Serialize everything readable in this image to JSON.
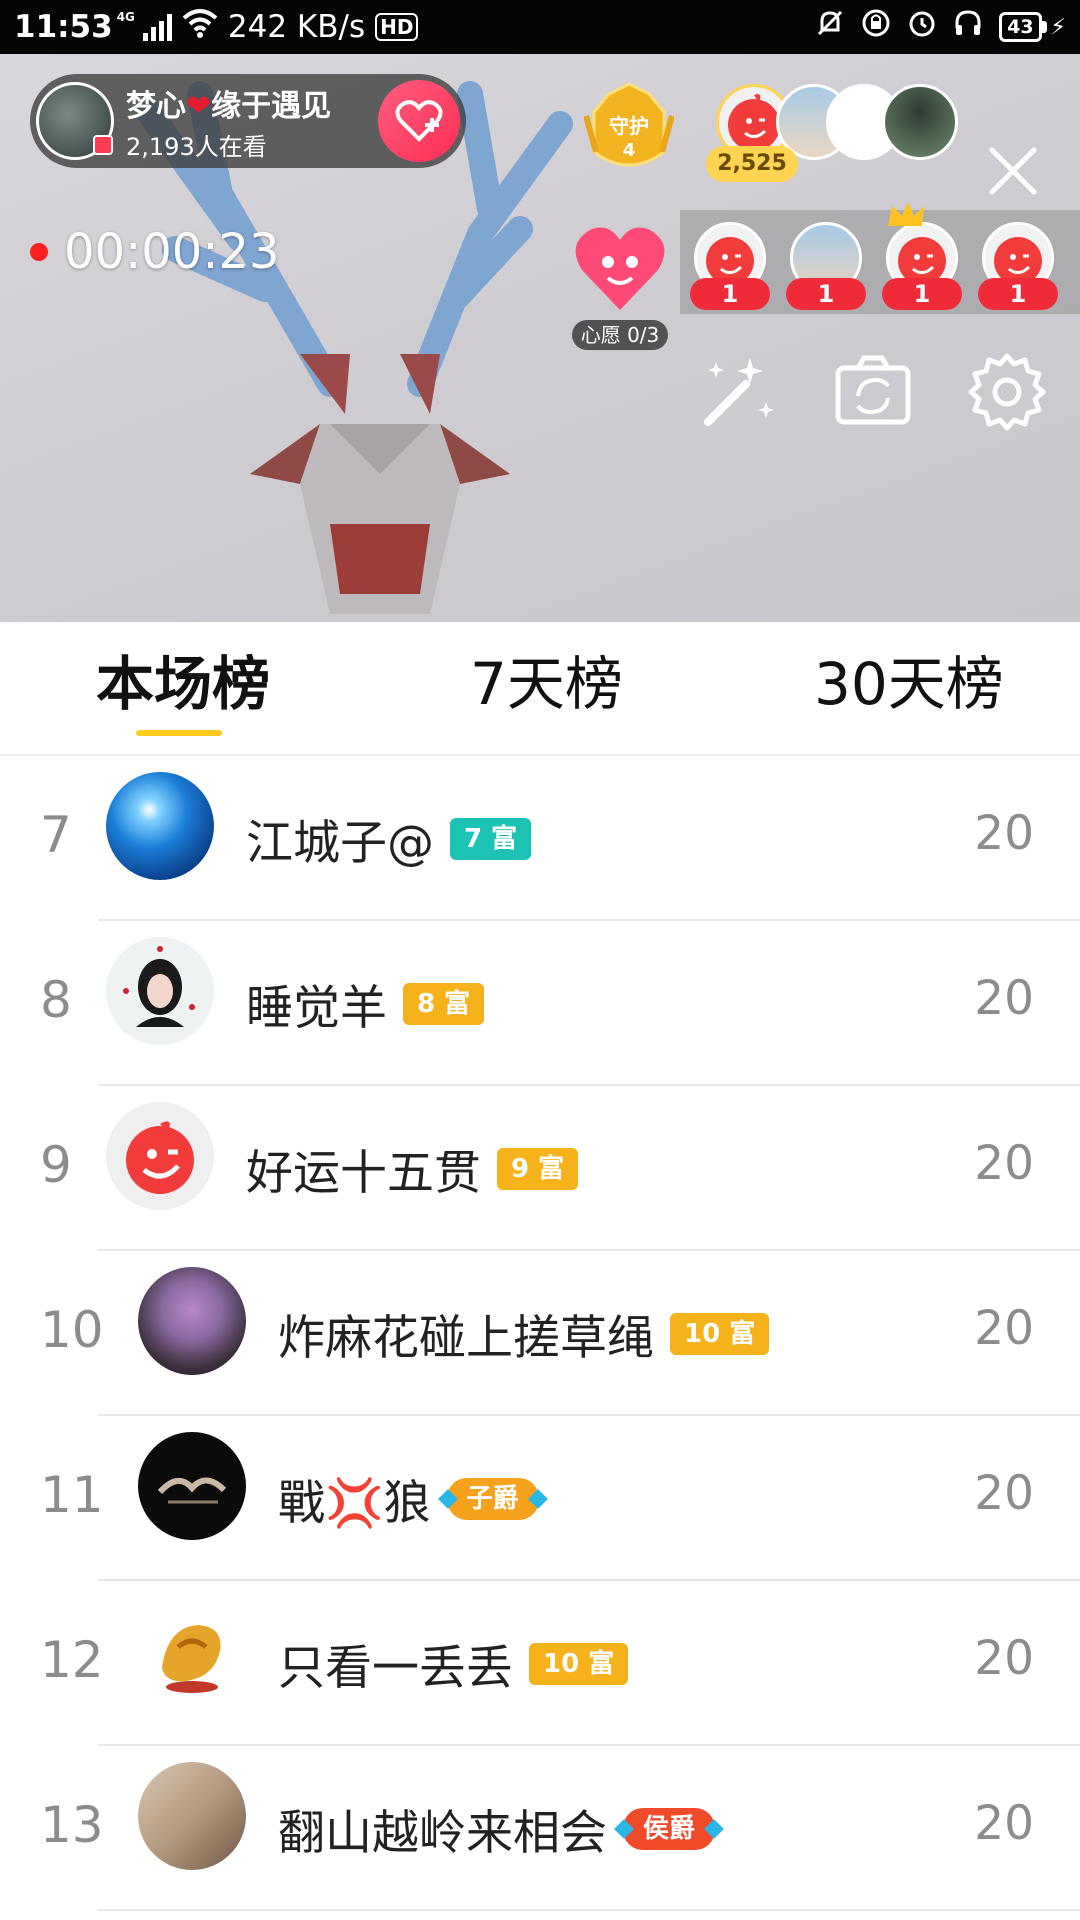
{
  "status_bar": {
    "time": "11:53",
    "network": "4G",
    "speed": "242 KB/s",
    "hd": "HD",
    "battery": "43"
  },
  "live": {
    "anchor_name": "梦心",
    "anchor_name_suffix": "缘于遇见",
    "viewers": "2,193人在看",
    "guard_label": "守护",
    "guard_count": "4",
    "score": "2,525",
    "timer": "00:00:23",
    "wish_label": "心愿 0/3",
    "fans": [
      {
        "count": "1",
        "style": "mascot"
      },
      {
        "count": "1",
        "style": "photo"
      },
      {
        "count": "1",
        "style": "crown"
      },
      {
        "count": "1",
        "style": "mascot"
      }
    ]
  },
  "tabs": [
    {
      "label": "本场榜",
      "active": true
    },
    {
      "label": "7天榜",
      "active": false
    },
    {
      "label": "30天榜",
      "active": false
    }
  ],
  "leaderboard": [
    {
      "rank": "7",
      "name": "江城子@",
      "badge": "7 富",
      "badge_color": "#1cc3b5",
      "badge_kind": "wealth",
      "score": "20",
      "avatar": "blue-light"
    },
    {
      "rank": "8",
      "name": "睡觉羊",
      "badge": "8 富",
      "badge_color": "#f5b21b",
      "badge_kind": "wealth",
      "score": "20",
      "avatar": "girl-portrait"
    },
    {
      "rank": "9",
      "name": "好运十五贯",
      "badge": "9 富",
      "badge_color": "#f5b21b",
      "badge_kind": "wealth",
      "score": "20",
      "avatar": "mascot"
    },
    {
      "rank": "10",
      "name": "炸麻花碰上搓草绳",
      "badge": "10 富",
      "badge_color": "#f5b21b",
      "badge_kind": "wealth",
      "score": "20",
      "avatar": "flowers"
    },
    {
      "rank": "11",
      "name": "戰💢狼",
      "badge": "子爵",
      "badge_color": "#f7a21c",
      "badge_kind": "noble",
      "score": "20",
      "avatar": "black-logo"
    },
    {
      "rank": "12",
      "name": "只看一丢丢",
      "badge": "10 富",
      "badge_color": "#f5b21b",
      "badge_kind": "wealth",
      "score": "20",
      "avatar": "gold-dragon"
    },
    {
      "rank": "13",
      "name": "翻山越岭来相会",
      "badge": "侯爵",
      "badge_color": "#ef4b2a",
      "badge_kind": "noble",
      "score": "20",
      "avatar": "climber"
    }
  ],
  "colors": {
    "accent_yellow": "#ffcc1e",
    "follow_pink": "#ff2d55",
    "recording_red": "#ff1f1f",
    "fan_badge_red": "#ef2b3a"
  }
}
